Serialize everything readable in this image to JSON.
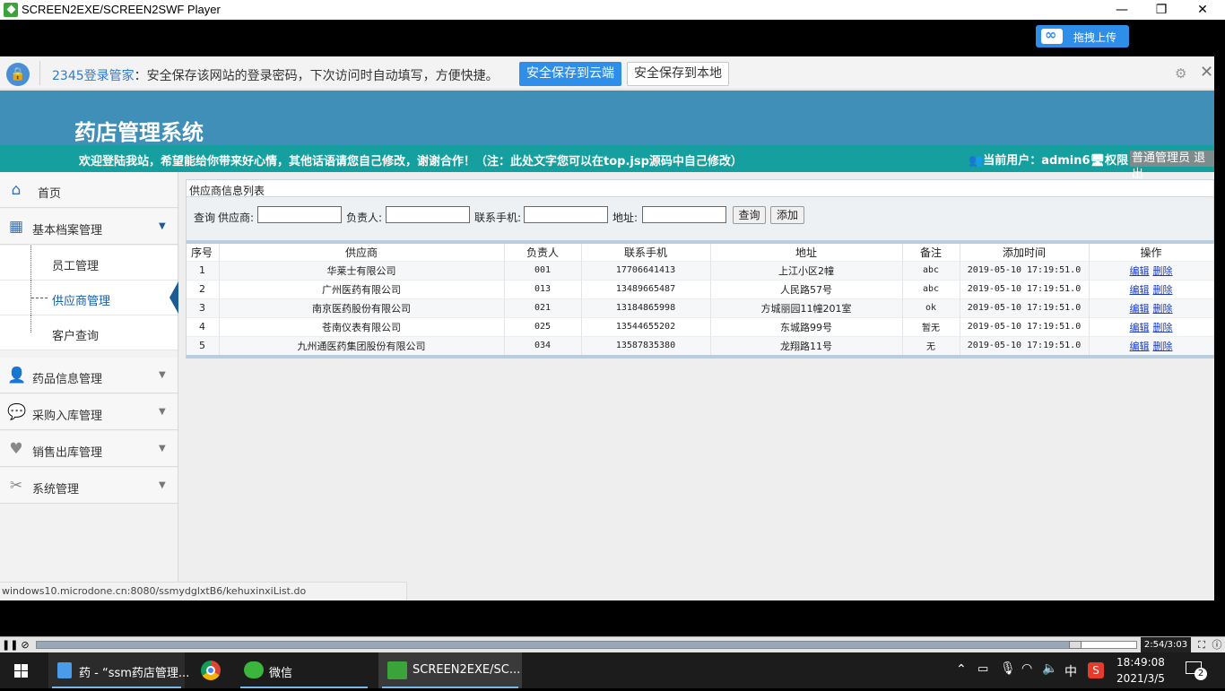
{
  "window": {
    "title": "SCREEN2EXE/SCREEN2SWF Player",
    "minimize": "—",
    "maximize": "❐",
    "close": "✕",
    "upload_label": "拖拽上传"
  },
  "password_bar": {
    "brand": "2345登录管家",
    "message": "：安全保存该网站的登录密码，下次访问时自动填写，方便快捷。",
    "save_cloud": "安全保存到云端",
    "save_local": "安全保存到本地",
    "gear": "⚙",
    "close": "✕"
  },
  "header": {
    "app_title": "药店管理系统",
    "welcome": "欢迎登陆我站，希望能给你带来好心情，其他话语请您自己修改，谢谢合作！（注：此处文字您可以在top.jsp源码中自己修改）",
    "user_label": "当前用户：admin6",
    "perm_label": "权限：",
    "role": "普通管理员 退出"
  },
  "sidebar": {
    "home": "首页",
    "groups": [
      {
        "label": "基本档案管理",
        "icon": "grid-icon"
      },
      {
        "label": "药品信息管理",
        "icon": "person-icon"
      },
      {
        "label": "采购入库管理",
        "icon": "chat-icon"
      },
      {
        "label": "销售出库管理",
        "icon": "heart-icon"
      },
      {
        "label": "系统管理",
        "icon": "tools-icon"
      }
    ],
    "subitems": [
      "员工管理",
      "供应商管理",
      "客户查询"
    ]
  },
  "panel": {
    "title": "供应商信息列表",
    "search": {
      "query_label": "查询",
      "supplier_label": "供应商:",
      "manager_label": "负责人:",
      "phone_label": "联系手机:",
      "address_label": "地址:",
      "query_button": "查询",
      "add_button": "添加"
    },
    "columns": [
      "序号",
      "供应商",
      "负责人",
      "联系手机",
      "地址",
      "备注",
      "添加时间",
      "操作"
    ],
    "rows": [
      {
        "no": "1",
        "supplier": "华莱士有限公司",
        "manager": "001",
        "phone": "17706641413",
        "address": "上江小区2幢",
        "note": "abc",
        "time": "2019-05-10 17:19:51.0"
      },
      {
        "no": "2",
        "supplier": "广州医药有限公司",
        "manager": "013",
        "phone": "13489665487",
        "address": "人民路57号",
        "note": "abc",
        "time": "2019-05-10 17:19:51.0"
      },
      {
        "no": "3",
        "supplier": "南京医药股份有限公司",
        "manager": "021",
        "phone": "13184865998",
        "address": "方城丽园11幢201室",
        "note": "ok",
        "time": "2019-05-10 17:19:51.0"
      },
      {
        "no": "4",
        "supplier": "苍南仪表有限公司",
        "manager": "025",
        "phone": "13544655202",
        "address": "东城路99号",
        "note": "暂无",
        "time": "2019-05-10 17:19:51.0"
      },
      {
        "no": "5",
        "supplier": "九州通医药集团股份有限公司",
        "manager": "034",
        "phone": "13587835380",
        "address": "龙翔路11号",
        "note": "无",
        "time": "2019-05-10 17:19:51.0"
      }
    ],
    "edit_link": "编辑",
    "delete_link": "删除"
  },
  "status_url": "windows10.microdone.cn:8080/ssmydglxtB6/kehuxinxiList.do",
  "player": {
    "time": "2:54/3:03",
    "progress": 0.95
  },
  "taskbar": {
    "items": [
      "药 - “ssm药店管理...",
      "微信",
      "SCREEN2EXE/SC..."
    ],
    "ime": "中",
    "time": "18:49:08",
    "date": "2021/3/5",
    "notifications": "2"
  }
}
